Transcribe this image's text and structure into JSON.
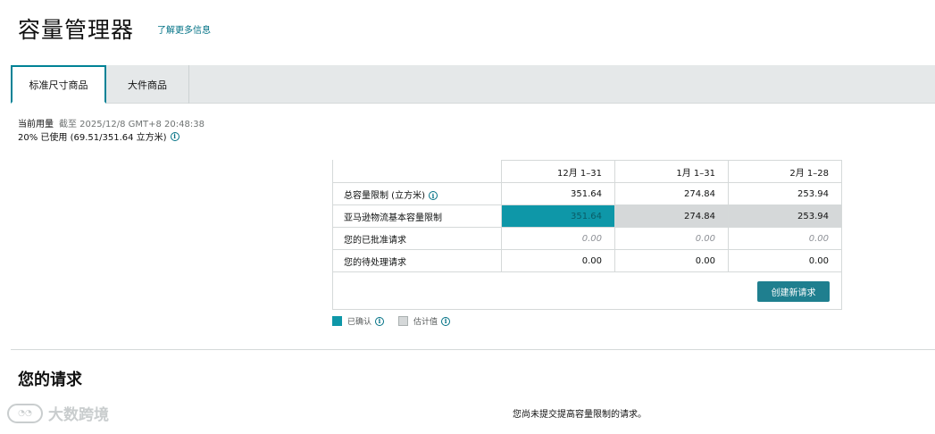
{
  "header": {
    "title": "容量管理器",
    "learn_more": "了解更多信息"
  },
  "tabs": [
    {
      "label": "标准尺寸商品",
      "active": true
    },
    {
      "label": "大件商品",
      "active": false
    }
  ],
  "usage": {
    "label": "当前用量",
    "as_of": "截至 2025/12/8 GMT+8 20:48:38",
    "summary": "20% 已使用 (69.51/351.64 立方米)"
  },
  "table": {
    "columns": [
      "12月 1–31",
      "1月 1–31",
      "2月 1–28"
    ],
    "rows": [
      {
        "label": "总容量限制 (立方米)",
        "values": [
          "351.64",
          "274.84",
          "253.94"
        ],
        "style": "bold"
      },
      {
        "label": "亚马逊物流基本容量限制",
        "values": [
          "351.64",
          "274.84",
          "253.94"
        ],
        "status": [
          "confirmed",
          "estimated",
          "estimated"
        ]
      },
      {
        "label": "您的已批准请求",
        "values": [
          "0.00",
          "0.00",
          "0.00"
        ],
        "style": "italic"
      },
      {
        "label": "您的待处理请求",
        "values": [
          "0.00",
          "0.00",
          "0.00"
        ],
        "style": "normal"
      }
    ],
    "new_request_button": "创建新请求"
  },
  "legend": {
    "confirmed": "已确认",
    "estimated": "估计值",
    "confirmed_color": "#0e97a8",
    "estimated_color": "#d5d8d9"
  },
  "requests": {
    "title": "您的请求",
    "empty_message": "您尚未提交提高容量限制的请求。"
  },
  "watermark": {
    "text": "大数跨境"
  },
  "colors": {
    "accent": "#008296",
    "button": "#1f7f8f",
    "link": "#007185"
  }
}
